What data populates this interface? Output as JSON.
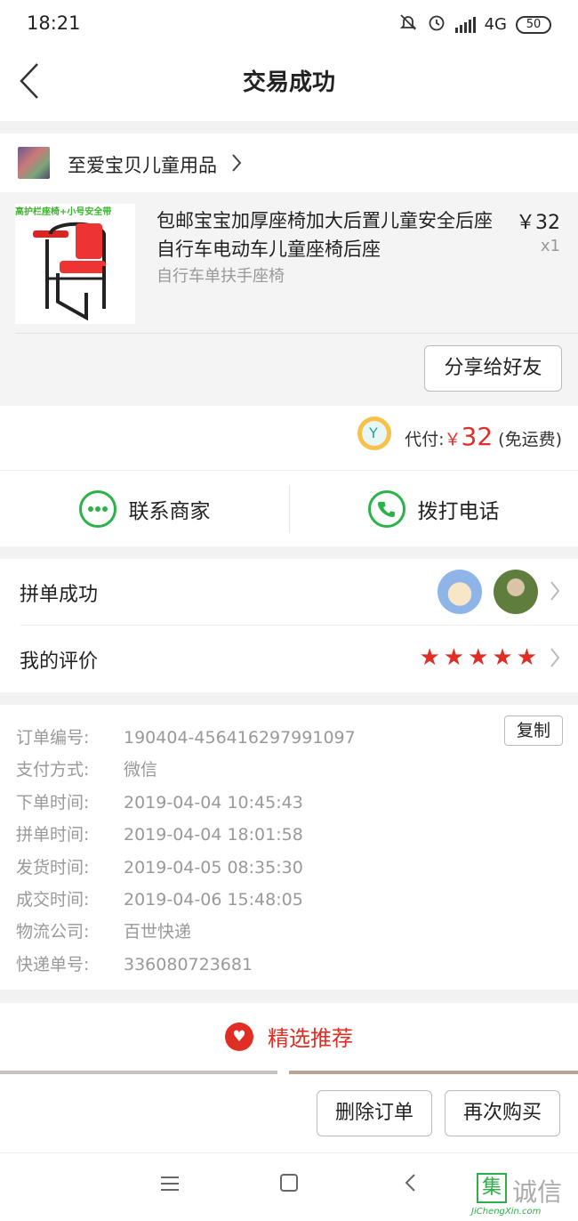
{
  "status_bar": {
    "time": "18:21",
    "network": "4G",
    "battery": "50"
  },
  "header": {
    "title": "交易成功"
  },
  "shop": {
    "name": "至爱宝贝儿童用品"
  },
  "product": {
    "thumb_tag": "高护栏座椅+小号安全带",
    "title": "包邮宝宝加厚座椅加大后置儿童安全后座自行车电动车儿童座椅后座",
    "price": "￥32",
    "quantity": "x1",
    "spec": "自行车单扶手座椅",
    "share_label": "分享给好友"
  },
  "payment": {
    "label": "代付:",
    "currency": "￥",
    "amount": "32",
    "note": "(免运费)"
  },
  "contact": {
    "merchant_label": "联系商家",
    "call_label": "拨打电话"
  },
  "group": {
    "success_label": "拼单成功",
    "review_label": "我的评价",
    "rating": 5
  },
  "order_info": {
    "copy_label": "复制",
    "fields": [
      {
        "key": "订单编号:",
        "value": "190404-456416297991097"
      },
      {
        "key": "支付方式:",
        "value": "微信"
      },
      {
        "key": "下单时间:",
        "value": "2019-04-04 10:45:43"
      },
      {
        "key": "拼单时间:",
        "value": "2019-04-04 18:01:58"
      },
      {
        "key": "发货时间:",
        "value": "2019-04-05 08:35:30"
      },
      {
        "key": "成交时间:",
        "value": "2019-04-06 15:48:05"
      },
      {
        "key": "物流公司:",
        "value": "百世快递"
      },
      {
        "key": "快递单号:",
        "value": "336080723681"
      }
    ]
  },
  "recommend": {
    "label": "精选推荐"
  },
  "actions": {
    "delete_label": "删除订单",
    "rebuy_label": "再次购买"
  },
  "watermark": {
    "char": "集",
    "text": "诚信",
    "url": "JiChengXin.com"
  },
  "colors": {
    "accent_red": "#e02e24",
    "wechat_green": "#2bb34a"
  }
}
